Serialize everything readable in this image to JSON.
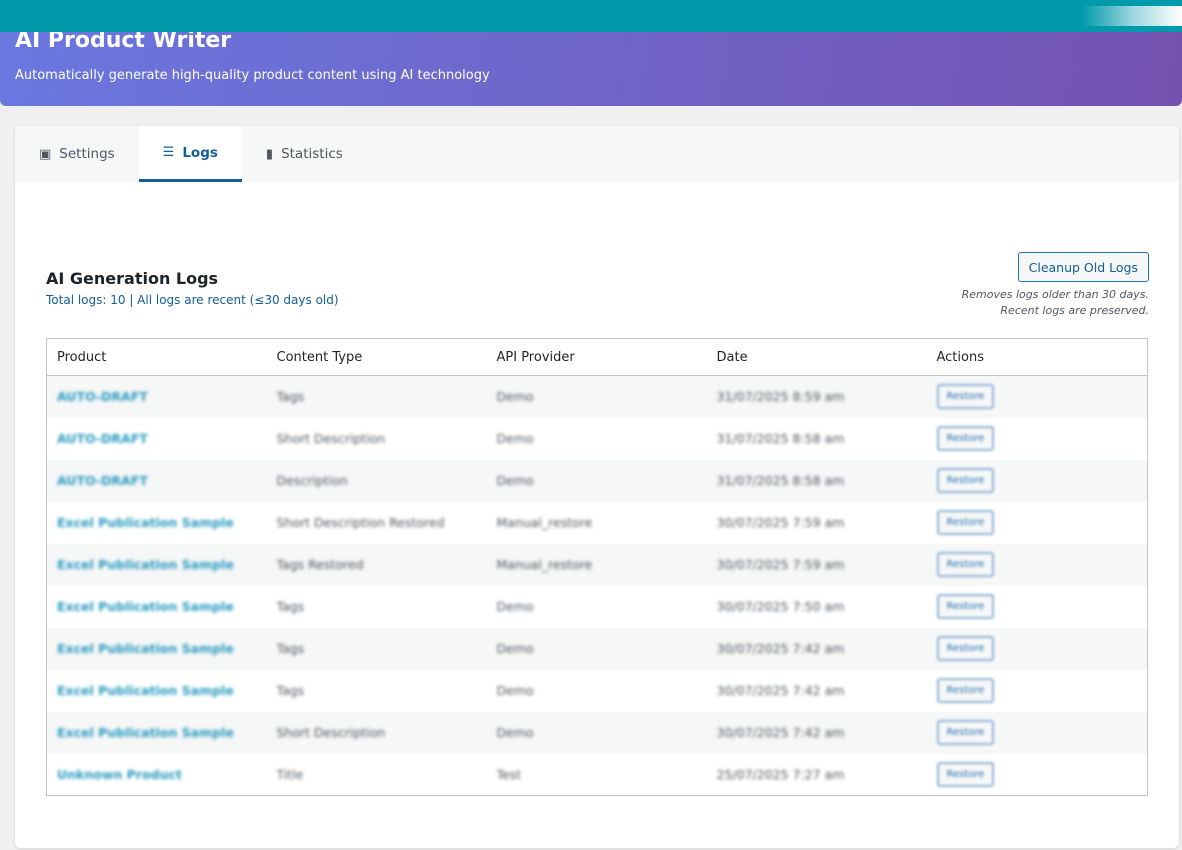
{
  "header": {
    "title": "AI Product Writer",
    "subtitle": "Automatically generate high-quality product content using AI technology"
  },
  "tabs": [
    {
      "label": "Settings",
      "icon": "settings-icon"
    },
    {
      "label": "Logs",
      "icon": "list-icon",
      "active": true
    },
    {
      "label": "Statistics",
      "icon": "bar-chart-icon"
    }
  ],
  "logs": {
    "title": "AI Generation Logs",
    "summary": "Total logs: 10 | All logs are recent (≤30 days old)",
    "cleanup_label": "Cleanup Old Logs",
    "note_line1": "Removes logs older than 30 days.",
    "note_line2": "Recent logs are preserved.",
    "columns": [
      "Product",
      "Content Type",
      "API Provider",
      "Date",
      "Actions"
    ],
    "rows": [
      {
        "product": "AUTO-DRAFT",
        "type": "Tags",
        "provider": "Demo",
        "date": "31/07/2025 8:59 am",
        "action": "Restore"
      },
      {
        "product": "AUTO-DRAFT",
        "type": "Short Description",
        "provider": "Demo",
        "date": "31/07/2025 8:58 am",
        "action": "Restore"
      },
      {
        "product": "AUTO-DRAFT",
        "type": "Description",
        "provider": "Demo",
        "date": "31/07/2025 8:58 am",
        "action": "Restore"
      },
      {
        "product": "Excel Publication Sample",
        "type": "Short Description Restored",
        "provider": "Manual_restore",
        "date": "30/07/2025 7:59 am",
        "action": "Restore"
      },
      {
        "product": "Excel Publication Sample",
        "type": "Tags Restored",
        "provider": "Manual_restore",
        "date": "30/07/2025 7:59 am",
        "action": "Restore"
      },
      {
        "product": "Excel Publication Sample",
        "type": "Tags",
        "provider": "Demo",
        "date": "30/07/2025 7:50 am",
        "action": "Restore"
      },
      {
        "product": "Excel Publication Sample",
        "type": "Tags",
        "provider": "Demo",
        "date": "30/07/2025 7:42 am",
        "action": "Restore"
      },
      {
        "product": "Excel Publication Sample",
        "type": "Tags",
        "provider": "Demo",
        "date": "30/07/2025 7:42 am",
        "action": "Restore"
      },
      {
        "product": "Excel Publication Sample",
        "type": "Short Description",
        "provider": "Demo",
        "date": "30/07/2025 7:42 am",
        "action": "Restore"
      },
      {
        "product": "Unknown Product",
        "type": "Title",
        "provider": "Test",
        "date": "25/07/2025 7:27 am",
        "action": "Restore"
      }
    ]
  }
}
